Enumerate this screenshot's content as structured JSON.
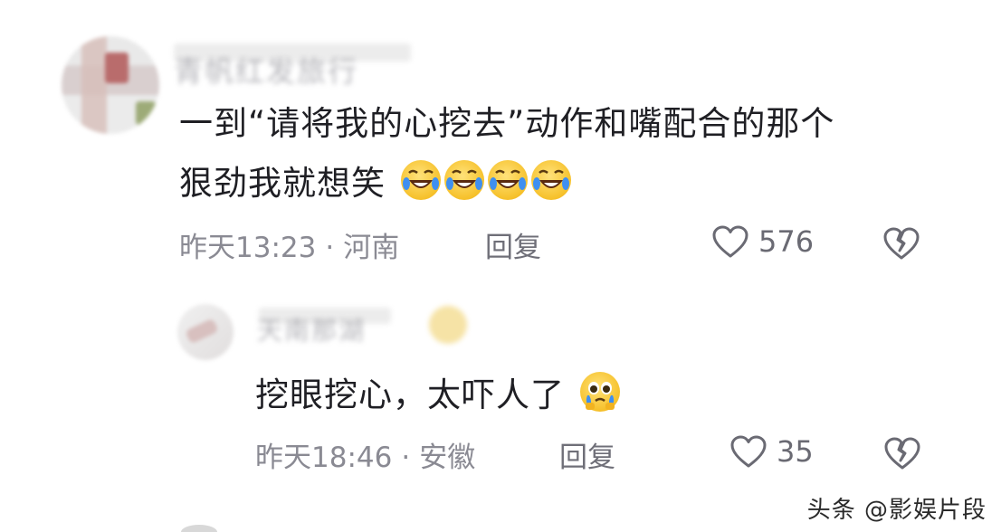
{
  "comments": [
    {
      "username": "青帆红发旅行",
      "text_line1": "一到“请将我的心挖去”动作和嘴配合的那个",
      "text_line2": "狠劲我就想笑",
      "emojis": [
        "rofl-emoji",
        "rofl-emoji",
        "rofl-emoji",
        "rofl-emoji"
      ],
      "time": "昨天13:23",
      "separator": "·",
      "location": "河南",
      "reply_label": "回复",
      "likes": "576",
      "like_icon": "heart-outline-icon",
      "dislike_icon": "broken-heart-icon"
    },
    {
      "username": "天南那湖",
      "text": "挖眼挖心，太吓人了",
      "emoji": "pleading-teary-emoji",
      "time": "昨天18:46",
      "separator": "·",
      "location": "安徽",
      "reply_label": "回复",
      "likes": "35",
      "like_icon": "heart-outline-icon",
      "dislike_icon": "broken-heart-icon"
    }
  ],
  "watermark": "头条 @影娱片段",
  "colors": {
    "background": "#ffffff",
    "text": "#1f1f24",
    "meta": "#8a8a93",
    "emoji": "#f6c12b"
  }
}
